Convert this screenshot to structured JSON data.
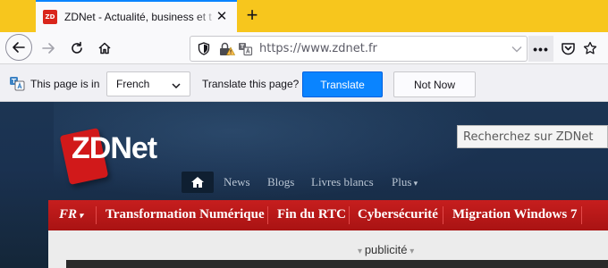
{
  "browser": {
    "tab": {
      "favicon": "ZD",
      "title": "ZDNet - Actualité, business et t",
      "close": "✕"
    },
    "new_tab": "+",
    "url": "https://www.zdnet.fr",
    "more": "•••"
  },
  "translate_bar": {
    "page_is_in": "This page is in",
    "language": "French",
    "question": "Translate this page?",
    "translate_btn": "Translate",
    "notnow_btn": "Not Now"
  },
  "site": {
    "logo": "ZDNet",
    "search_placeholder": "Recherchez sur ZDNet",
    "nav": [
      "News",
      "Blogs",
      "Livres blancs",
      "Plus"
    ],
    "edition": "FR",
    "sections": [
      "Transformation Numérique",
      "Fin du RTC",
      "Cybersécurité",
      "Migration Windows 7"
    ],
    "ad_label": "publicité"
  },
  "colors": {
    "accent": "#0a84ff",
    "tabstrip": "#f7c61d",
    "site_red": "#c61e1e",
    "site_navy": "#1c3553"
  },
  "icons": [
    "back-arrow-icon",
    "forward-arrow-icon",
    "reload-icon",
    "home-icon",
    "shield-icon",
    "lock-warning-icon",
    "translate-icon",
    "bookmark-star-icon",
    "pocket-icon",
    "dropdown-chevron-icon"
  ]
}
